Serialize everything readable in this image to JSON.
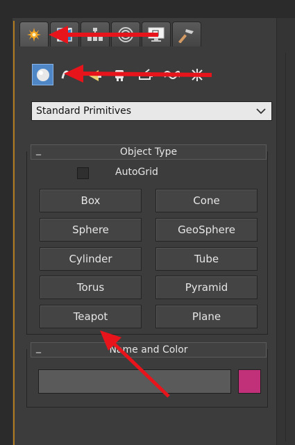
{
  "command_panel": {
    "tabs": [
      {
        "icon": "create-icon",
        "active": true
      },
      {
        "icon": "modify-icon",
        "active": false
      },
      {
        "icon": "hierarchy-icon",
        "active": false
      },
      {
        "icon": "motion-icon",
        "active": false
      },
      {
        "icon": "display-icon",
        "active": false
      },
      {
        "icon": "utilities-icon",
        "active": false
      }
    ],
    "subcategories": [
      {
        "icon": "geometry-icon",
        "active": true
      },
      {
        "icon": "shapes-icon",
        "active": false
      },
      {
        "icon": "lights-icon",
        "active": false
      },
      {
        "icon": "cameras-icon",
        "active": false
      },
      {
        "icon": "helpers-icon",
        "active": false
      },
      {
        "icon": "space-warps-icon",
        "active": false
      },
      {
        "icon": "systems-icon",
        "active": false
      }
    ],
    "category_dropdown": {
      "selected": "Standard Primitives"
    }
  },
  "object_type": {
    "title": "Object Type",
    "collapse_symbol": "_",
    "autogrid": {
      "label": "AutoGrid",
      "checked": false
    },
    "buttons": [
      "Box",
      "Cone",
      "Sphere",
      "GeoSphere",
      "Cylinder",
      "Tube",
      "Torus",
      "Pyramid",
      "Teapot",
      "Plane"
    ]
  },
  "name_and_color": {
    "title": "Name and Color",
    "collapse_symbol": "_",
    "name_value": "",
    "color": "#c0317a"
  },
  "annotations": {
    "arrow_color": "#e8141c"
  }
}
